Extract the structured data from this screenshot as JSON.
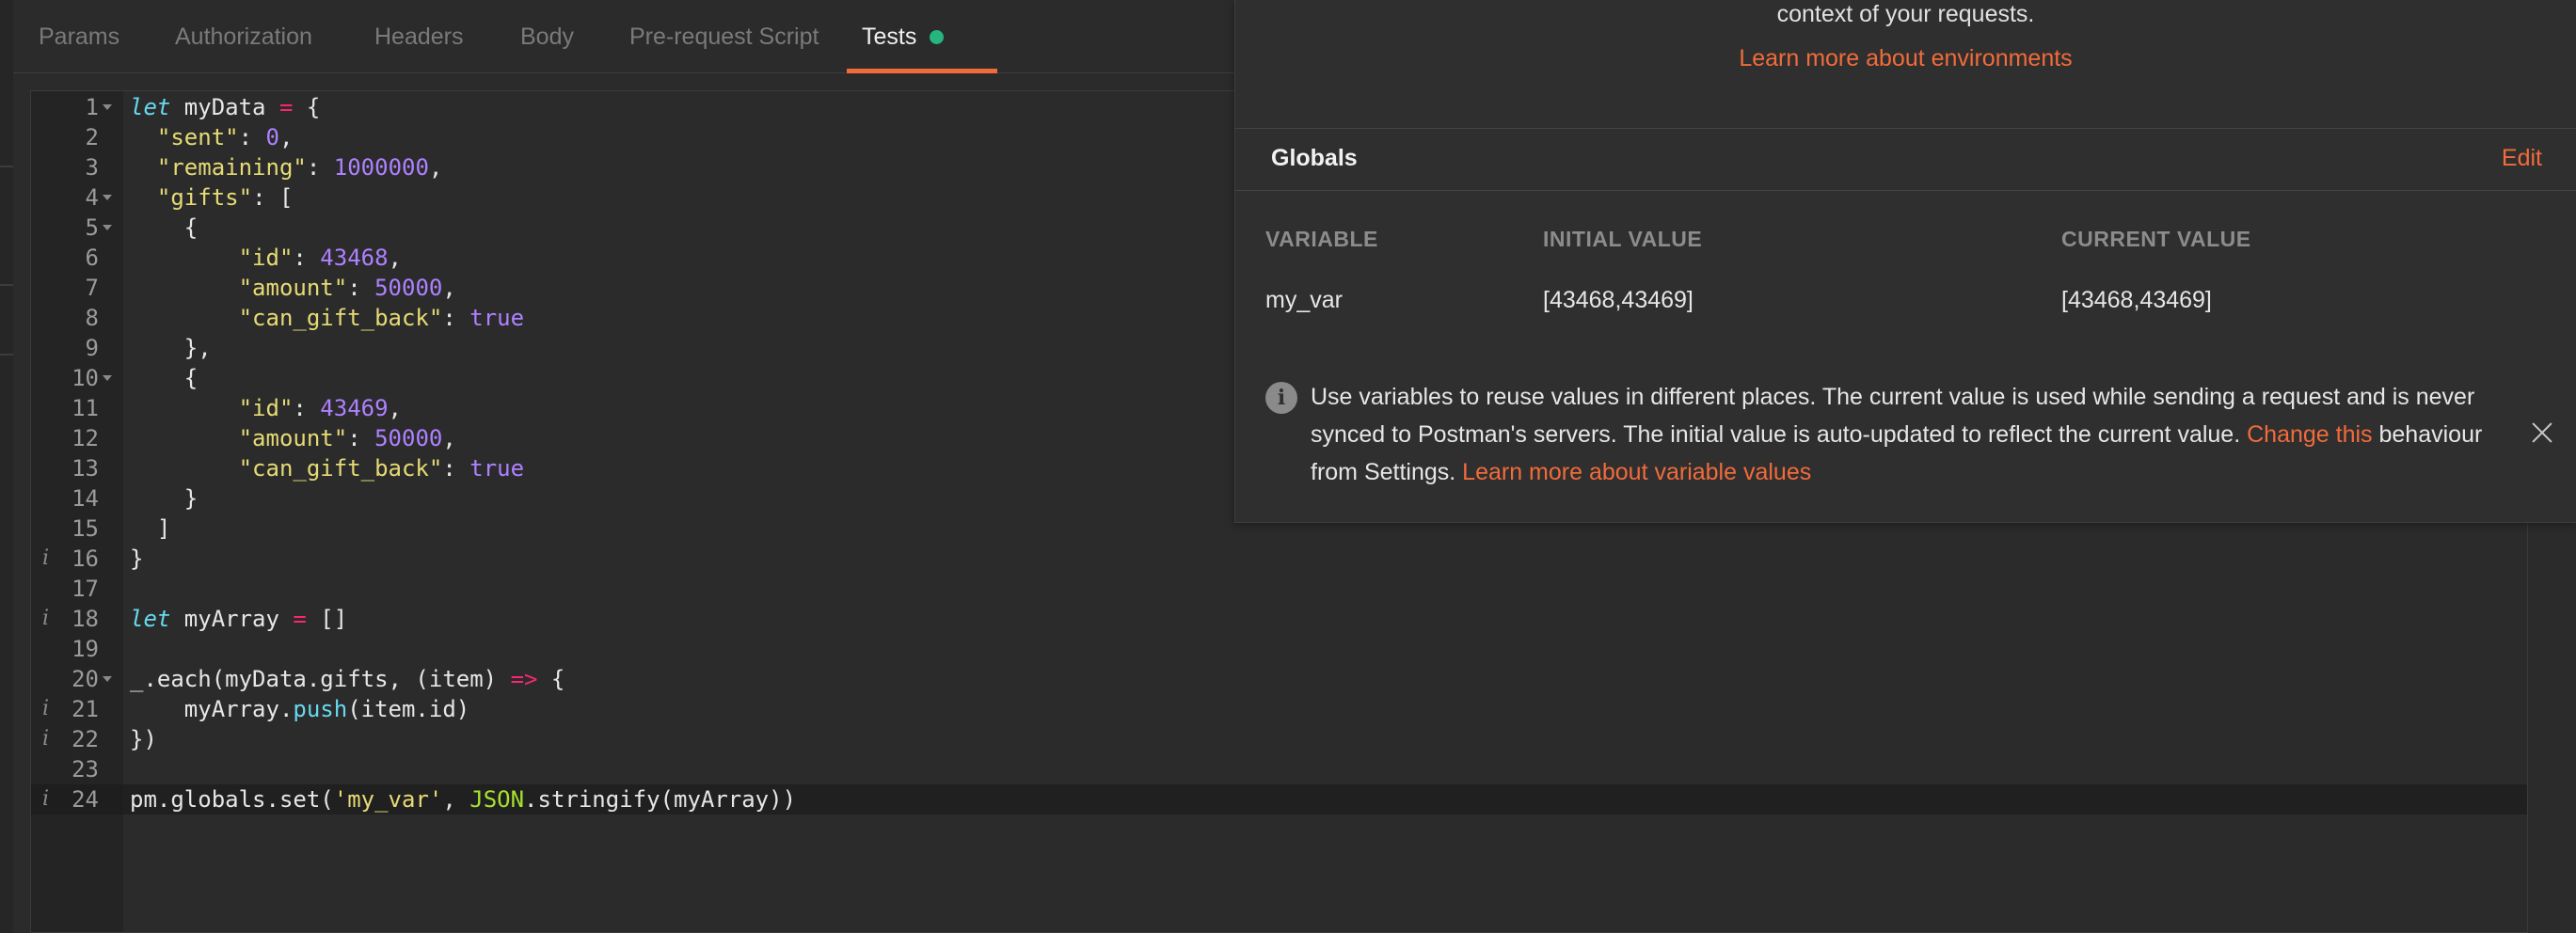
{
  "tabs": [
    {
      "label": "Params"
    },
    {
      "label": "Authorization"
    },
    {
      "label": "Headers"
    },
    {
      "label": "Body"
    },
    {
      "label": "Pre-request Script"
    },
    {
      "label": "Tests"
    }
  ],
  "editor": {
    "lines": [
      {
        "num": "1"
      },
      {
        "num": "2"
      },
      {
        "num": "3"
      },
      {
        "num": "4"
      },
      {
        "num": "5"
      },
      {
        "num": "6"
      },
      {
        "num": "7"
      },
      {
        "num": "8"
      },
      {
        "num": "9"
      },
      {
        "num": "10"
      },
      {
        "num": "11"
      },
      {
        "num": "12"
      },
      {
        "num": "13"
      },
      {
        "num": "14"
      },
      {
        "num": "15"
      },
      {
        "num": "16",
        "info": "i"
      },
      {
        "num": "17"
      },
      {
        "num": "18",
        "info": "i"
      },
      {
        "num": "19"
      },
      {
        "num": "20"
      },
      {
        "num": "21",
        "info": "i"
      },
      {
        "num": "22",
        "info": "i"
      },
      {
        "num": "23"
      },
      {
        "num": "24",
        "info": "i"
      }
    ],
    "tokens": {
      "l1": [
        "let",
        " myData ",
        "=",
        " {"
      ],
      "l2": [
        "  ",
        "\"sent\"",
        ": ",
        "0",
        ","
      ],
      "l3": [
        "  ",
        "\"remaining\"",
        ": ",
        "1000000",
        ","
      ],
      "l4": [
        "  ",
        "\"gifts\"",
        ": ["
      ],
      "l5": [
        "    {"
      ],
      "l6": [
        "        ",
        "\"id\"",
        ": ",
        "43468",
        ","
      ],
      "l7": [
        "        ",
        "\"amount\"",
        ": ",
        "50000",
        ","
      ],
      "l8": [
        "        ",
        "\"can_gift_back\"",
        ": ",
        "true"
      ],
      "l9": [
        "    },"
      ],
      "l10": [
        "    {"
      ],
      "l11": [
        "        ",
        "\"id\"",
        ": ",
        "43469",
        ","
      ],
      "l12": [
        "        ",
        "\"amount\"",
        ": ",
        "50000",
        ","
      ],
      "l13": [
        "        ",
        "\"can_gift_back\"",
        ": ",
        "true"
      ],
      "l14": [
        "    }"
      ],
      "l15": [
        "  ]"
      ],
      "l16": [
        "}"
      ],
      "l18": [
        "let",
        " myArray ",
        "=",
        " []"
      ],
      "l20": [
        "_.each(myData.gifts, (item) ",
        "=>",
        " {"
      ],
      "l21": [
        "    myArray.",
        "push",
        "(item.id)"
      ],
      "l22": [
        "})"
      ],
      "l24": [
        "pm.globals.set(",
        "'my_var'",
        ", ",
        "JSON",
        ".stringify(myArray))"
      ]
    }
  },
  "panel": {
    "env_desc": "context of your requests.",
    "env_link": "Learn more about environments",
    "globals_title": "Globals",
    "edit_label": "Edit",
    "columns": [
      "VARIABLE",
      "INITIAL VALUE",
      "CURRENT VALUE"
    ],
    "rows": [
      {
        "variable": "my_var",
        "initial": "[43468,43469]",
        "current": "[43468,43469]"
      }
    ],
    "info": {
      "text1": "Use variables to reuse values in different places. The current value is used while sending a request and is never synced to Postman's servers. The initial value is auto-updated to reflect the current value. ",
      "link1": "Change this",
      "text2": " behaviour from Settings. ",
      "link2": "Learn more about variable values"
    }
  },
  "colors": {
    "accent": "#f26b3a",
    "active_dot": "#26b47f",
    "background": "#2b2b2b"
  }
}
